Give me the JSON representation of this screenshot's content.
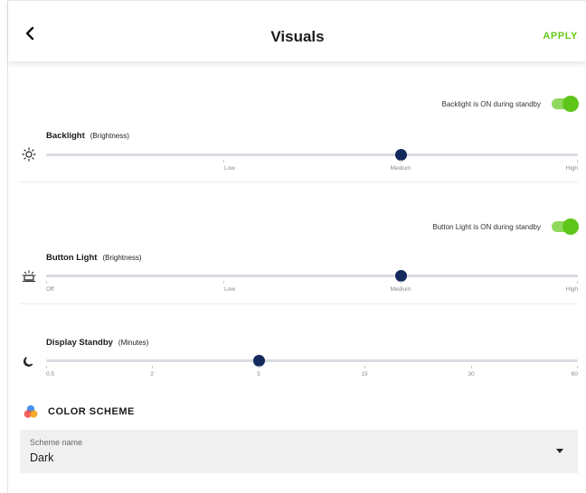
{
  "header": {
    "title": "Visuals",
    "apply_label": "APPLY"
  },
  "colors": {
    "accent_green": "#66cc1a",
    "slider_thumb": "#14295c",
    "track": "#d8dbe0"
  },
  "backlight": {
    "standby_label": "Backlight is ON during standby",
    "standby_on": true,
    "title": "Backlight",
    "subtitle": "(Brightness)",
    "icon": "sun-icon",
    "ticks": [
      "",
      "Low",
      "Medium",
      "High"
    ],
    "value": "Medium"
  },
  "button_light": {
    "standby_label": "Button Light is ON during standby",
    "standby_on": true,
    "title": "Button Light",
    "subtitle": "(Brightness)",
    "icon": "button-light-icon",
    "ticks": [
      "Off",
      "Low",
      "Medium",
      "High"
    ],
    "value": "Medium"
  },
  "display_standby": {
    "title": "Display Standby",
    "subtitle": "(Minutes)",
    "icon": "moon-icon",
    "ticks": [
      "0.5",
      "2",
      "5",
      "15",
      "30",
      "60"
    ],
    "value": "5"
  },
  "color_scheme": {
    "title": "COLOR SCHEME",
    "icon": "color-palette-icon",
    "field_label": "Scheme name",
    "field_value": "Dark"
  }
}
